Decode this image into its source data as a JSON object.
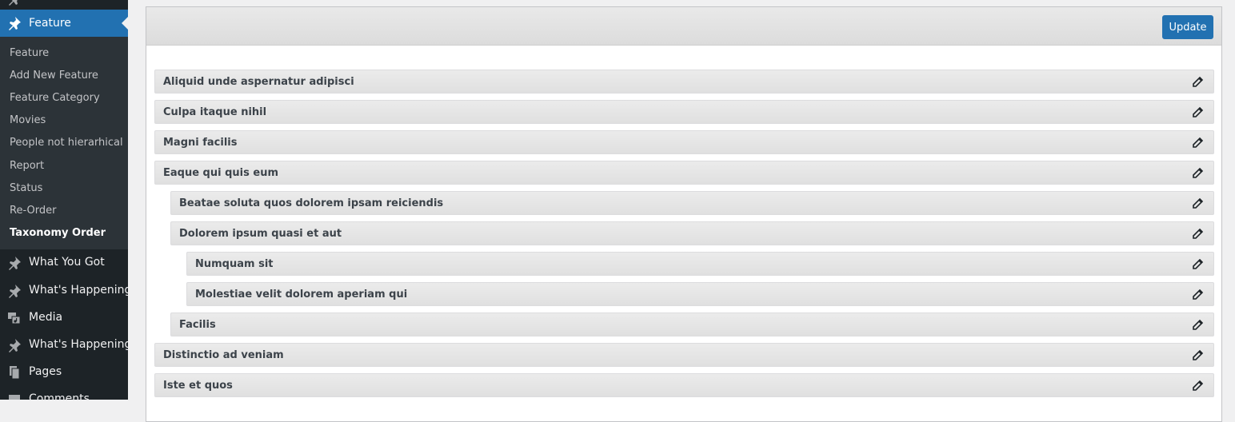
{
  "sidebar": {
    "current": {
      "label": "Feature",
      "icon": "pin-icon"
    },
    "submenu": [
      {
        "label": "Feature",
        "active": false
      },
      {
        "label": "Add New Feature",
        "active": false
      },
      {
        "label": "Feature Category",
        "active": false
      },
      {
        "label": "Movies",
        "active": false
      },
      {
        "label": "People not hierarhical",
        "active": false
      },
      {
        "label": "Report",
        "active": false
      },
      {
        "label": "Status",
        "active": false
      },
      {
        "label": "Re-Order",
        "active": false
      },
      {
        "label": "Taxonomy Order",
        "active": true
      }
    ],
    "items": [
      {
        "label": "What You Got",
        "icon": "pin-icon"
      },
      {
        "label": "What's Happening",
        "icon": "pin-icon"
      },
      {
        "label": "Media",
        "icon": "media-icon"
      },
      {
        "label": "What's Happening",
        "icon": "pin-icon"
      },
      {
        "label": "Pages",
        "icon": "pages-icon"
      },
      {
        "label": "Comments",
        "icon": "comments-icon"
      }
    ]
  },
  "toolbar": {
    "update_label": "Update"
  },
  "terms": [
    {
      "label": "Aliquid unde aspernatur adipisci",
      "level": 0
    },
    {
      "label": "Culpa itaque nihil",
      "level": 0
    },
    {
      "label": "Magni facilis",
      "level": 0
    },
    {
      "label": "Eaque qui quis eum",
      "level": 0
    },
    {
      "label": "Beatae soluta quos dolorem ipsam reiciendis",
      "level": 1
    },
    {
      "label": "Dolorem ipsum quasi et aut",
      "level": 1
    },
    {
      "label": "Numquam sit",
      "level": 2
    },
    {
      "label": "Molestiae velit dolorem aperiam qui",
      "level": 2
    },
    {
      "label": "Facilis",
      "level": 1
    },
    {
      "label": "Distinctio ad veniam",
      "level": 0
    },
    {
      "label": "Iste et quos",
      "level": 0
    }
  ],
  "colors": {
    "accent": "#2271b1",
    "sidebar": "#1d2327",
    "submenu": "#2c3338"
  }
}
